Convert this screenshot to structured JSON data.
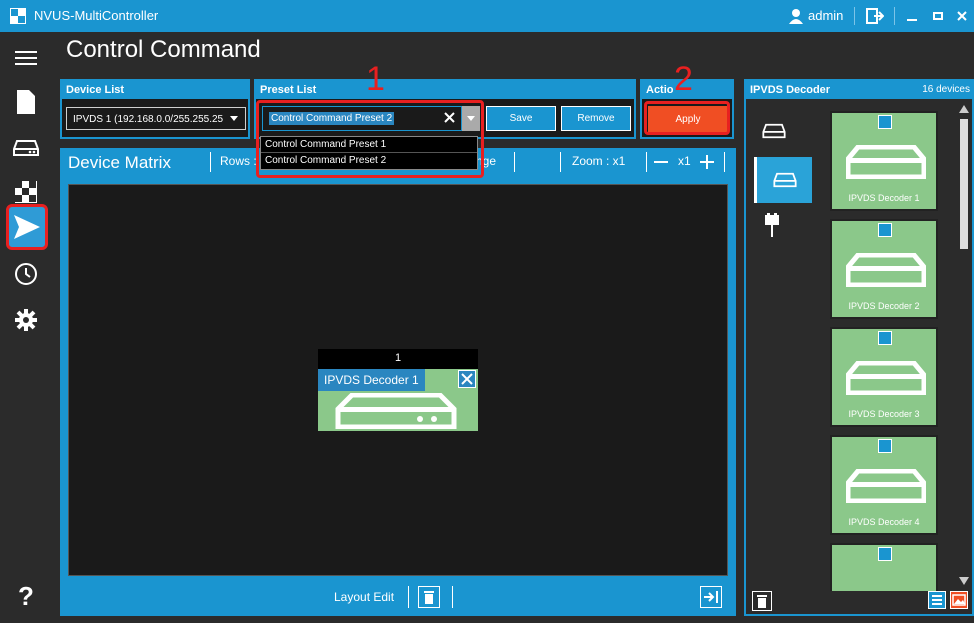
{
  "window": {
    "title": "NVUS-MultiController",
    "user": "admin"
  },
  "page": {
    "title": "Control Command"
  },
  "device_list": {
    "label": "Device List",
    "selected": "IPVDS 1 (192.168.0.0/255.255.25"
  },
  "preset_list": {
    "label": "Preset List",
    "selected": "Control Command Preset 2",
    "options": [
      "Control Command Preset 1",
      "Control Command Preset 2"
    ],
    "save_label": "Save",
    "remove_label": "Remove"
  },
  "action": {
    "label": "Actio",
    "apply_label": "Apply"
  },
  "matrix": {
    "title": "Device Matrix",
    "rows_label": "Rows :",
    "range_fragment": "nge",
    "zoom_label": "Zoom : x1",
    "zoom_value": "x1",
    "cell": {
      "index": "1",
      "decoder": "IPVDS Decoder 1"
    },
    "layout_edit_label": "Layout Edit"
  },
  "decoder_panel": {
    "title": "IPVDS Decoder",
    "count": "16 devices",
    "items": [
      "IPVDS Decoder 1",
      "IPVDS Decoder 2",
      "IPVDS Decoder 3",
      "IPVDS Decoder 4"
    ]
  },
  "callouts": [
    "1",
    "2"
  ],
  "colors": {
    "accent": "#1a95d0",
    "apply": "#f04e23",
    "highlight": "#e82020",
    "thumb": "#8bc88a"
  }
}
